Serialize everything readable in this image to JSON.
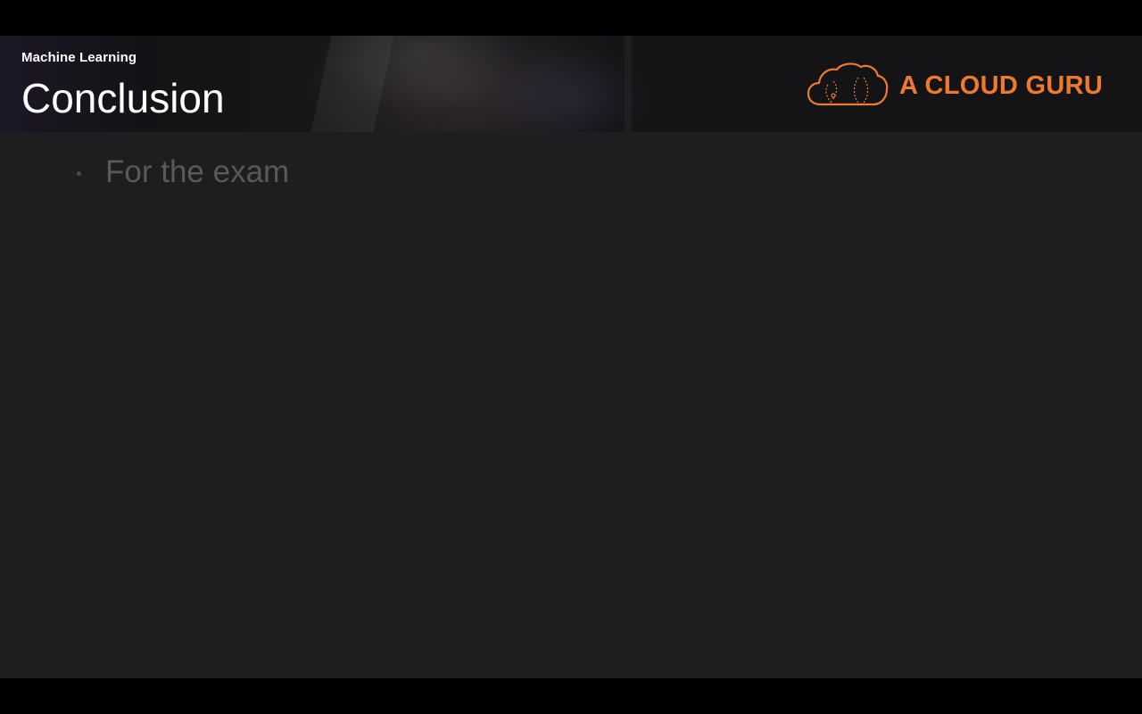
{
  "slide": {
    "subtitle": "Machine Learning",
    "title": "Conclusion",
    "logo": {
      "text": "A CLOUD GURU",
      "icon": "cloud-logo-icon",
      "color": "#ee7a2d"
    },
    "bullets": [
      {
        "text": "For the exam"
      }
    ]
  },
  "colors": {
    "slide_background": "#1f1d20",
    "header_background": "#141315",
    "bullet_text": "#5a585b",
    "accent": "#ee7a2d"
  }
}
